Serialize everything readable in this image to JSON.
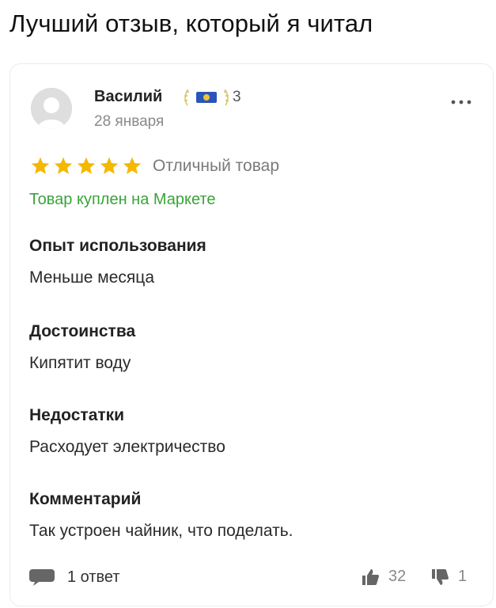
{
  "headline": "Лучший отзыв, который я читал",
  "review": {
    "author": "Василий",
    "badge_count": "3",
    "date": "28 января",
    "rating": 5,
    "rating_text": "Отличный товар",
    "purchase_note": "Товар куплен на Маркете",
    "sections": [
      {
        "title": "Опыт использования",
        "text": "Меньше месяца"
      },
      {
        "title": "Достоинства",
        "text": "Кипятит воду"
      },
      {
        "title": "Недостатки",
        "text": "Расходует электричество"
      },
      {
        "title": "Комментарий",
        "text": "Так устроен чайник, что поделать."
      }
    ],
    "replies_label": "1 ответ",
    "likes": "32",
    "dislikes": "1"
  },
  "colors": {
    "star": "#f5b800",
    "purchase_note": "#3aa33a",
    "badge": "#2a55b8"
  },
  "icons": {
    "avatar": "avatar-placeholder-icon",
    "badge": "laurel-badge-icon",
    "more": "more-dots-icon",
    "reply": "speech-bubble-icon",
    "like": "thumbs-up-icon",
    "dislike": "thumbs-down-icon"
  }
}
